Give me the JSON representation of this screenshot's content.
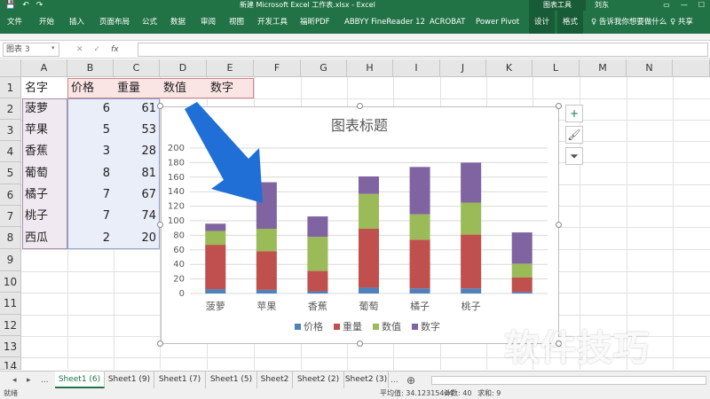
{
  "titlebar": {
    "title": "新建 Microsoft Excel 工作表.xlsx - Excel",
    "context_group": "图表工具",
    "user": "刘东",
    "qat": [
      "💾",
      "↶",
      "↷"
    ]
  },
  "ribbon": {
    "tabs": [
      "文件",
      "开始",
      "插入",
      "页面布局",
      "公式",
      "数据",
      "审阅",
      "视图",
      "开发工具",
      "福昕PDF",
      "ABBYY FineReader 12",
      "ACROBAT",
      "Power Pivot",
      "设计",
      "格式"
    ],
    "tell_me": "♀ 告诉我你想要做什么",
    "share": "♀ 共享"
  },
  "formula_bar": {
    "name_box": "图表 3",
    "fx": "fx"
  },
  "columns": [
    "A",
    "B",
    "C",
    "D",
    "E",
    "F",
    "G",
    "H",
    "I",
    "J",
    "K",
    "L",
    "M",
    "N"
  ],
  "rows": [
    "1",
    "2",
    "3",
    "4",
    "5",
    "6",
    "7",
    "8",
    "9",
    "10",
    "11",
    "12",
    "13",
    "14"
  ],
  "table": {
    "headers": [
      "名字",
      "价格",
      "重量",
      "数值",
      "数字"
    ],
    "rows": [
      {
        "name": "菠萝",
        "price": "6",
        "weight": "61"
      },
      {
        "name": "苹果",
        "price": "5",
        "weight": "53"
      },
      {
        "name": "香蕉",
        "price": "3",
        "weight": "28"
      },
      {
        "name": "葡萄",
        "price": "8",
        "weight": "81"
      },
      {
        "name": "橘子",
        "price": "7",
        "weight": "67"
      },
      {
        "name": "桃子",
        "price": "7",
        "weight": "74"
      },
      {
        "name": "西瓜",
        "price": "2",
        "weight": "20"
      }
    ]
  },
  "chart_data": {
    "type": "bar",
    "stacked": true,
    "title": "图表标题",
    "categories": [
      "菠萝",
      "苹果",
      "香蕉",
      "葡萄",
      "橘子",
      "桃子",
      ""
    ],
    "series": [
      {
        "name": "价格",
        "color": "#4f81bd",
        "values": [
          6,
          5,
          3,
          8,
          7,
          7,
          2
        ]
      },
      {
        "name": "重量",
        "color": "#c0504d",
        "values": [
          61,
          53,
          28,
          81,
          67,
          74,
          20
        ]
      },
      {
        "name": "数值",
        "color": "#9bbb59",
        "values": [
          19,
          31,
          47,
          48,
          35,
          44,
          19
        ]
      },
      {
        "name": "数字",
        "color": "#8064a2",
        "values": [
          10,
          64,
          28,
          24,
          65,
          55,
          43
        ]
      }
    ],
    "ylim": [
      0,
      200
    ],
    "yticks": [
      "0",
      "20",
      "40",
      "60",
      "80",
      "100",
      "120",
      "140",
      "160",
      "180",
      "200"
    ],
    "grid": true,
    "legend": "bottom"
  },
  "chart_buttons": [
    "+",
    "🖌",
    "⏷"
  ],
  "sheet_tabs": {
    "nav": [
      "◂",
      "▸",
      "..."
    ],
    "tabs": [
      "Sheet1 (6)",
      "Sheet1 (9)",
      "Sheet1 (7)",
      "Sheet1 (5)",
      "Sheet2",
      "Sheet2 (2)",
      "Sheet2 (3)",
      "..."
    ],
    "add": "⊕"
  },
  "status": {
    "mode": "就绪",
    "average": "平均值: 34.12315444",
    "count": "计数: 40",
    "sum": "求和: 9"
  },
  "watermark": "软件技巧"
}
